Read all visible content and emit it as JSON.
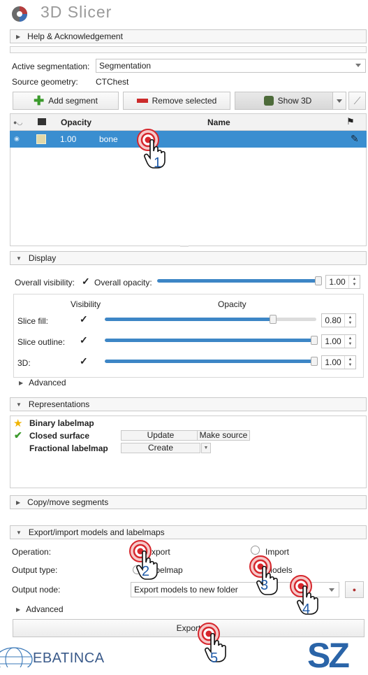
{
  "app": {
    "title": "3D Slicer"
  },
  "help_section": {
    "label": "Help & Acknowledgement"
  },
  "segmentation": {
    "active_label": "Active segmentation:",
    "active_value": "Segmentation",
    "source_label": "Source geometry:",
    "source_value": "CTChest"
  },
  "toolbar": {
    "add_label": "Add segment",
    "remove_label": "Remove selected",
    "show3d_label": "Show 3D"
  },
  "segments_table": {
    "headers": {
      "opacity": "Opacity",
      "name": "Name"
    },
    "rows": [
      {
        "opacity": "1.00",
        "name": "bone",
        "color": "#e1d8a8"
      }
    ]
  },
  "display": {
    "header": "Display",
    "overall_visibility_label": "Overall visibility:",
    "overall_opacity_label": "Overall opacity:",
    "overall_opacity_value": "1.00",
    "col_visibility": "Visibility",
    "col_opacity": "Opacity",
    "rows": [
      {
        "label": "Slice fill:",
        "value": "0.80"
      },
      {
        "label": "Slice outline:",
        "value": "1.00"
      },
      {
        "label": "3D:",
        "value": "1.00"
      }
    ],
    "advanced_label": "Advanced"
  },
  "representations": {
    "header": "Representations",
    "items": [
      {
        "name": "Binary labelmap"
      },
      {
        "name": "Closed surface",
        "action": "Update",
        "extra": "Make source"
      },
      {
        "name": "Fractional labelmap",
        "action": "Create"
      }
    ]
  },
  "copy_move": {
    "label": "Copy/move segments"
  },
  "export_import": {
    "header": "Export/import models and labelmaps",
    "operation_label": "Operation:",
    "export_option": "Export",
    "import_option": "Import",
    "output_type_label": "Output type:",
    "labelmap_option": "Labelmap",
    "models_option": "Models",
    "output_node_label": "Output node:",
    "output_node_value": "Export models to new folder",
    "advanced_label": "Advanced",
    "export_button": "Export"
  },
  "markers": [
    "1",
    "2",
    "3",
    "4",
    "5"
  ],
  "footer": {
    "left_logo": "EBATINCA",
    "right_logo": "SZ"
  },
  "colors": {
    "accent": "#3a8ed0",
    "slider": "#3d86c6",
    "marker": "#d6262c",
    "marker_number": "#1e5aa8",
    "remove_red": "#cc2b2b",
    "add_green": "#3b9a2c"
  }
}
